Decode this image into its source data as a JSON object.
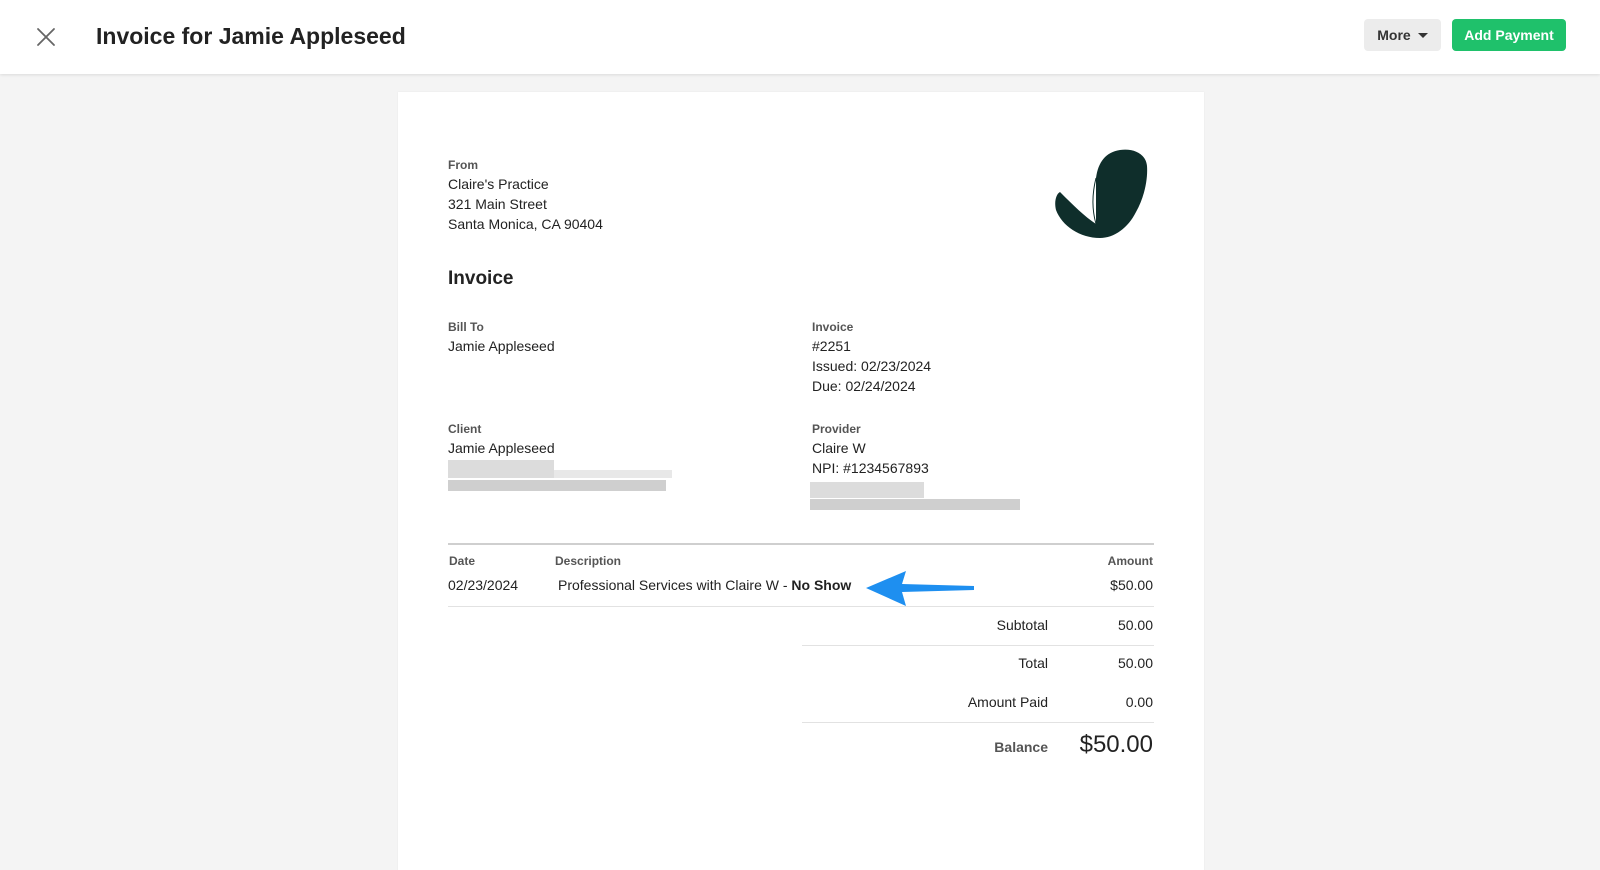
{
  "header": {
    "title": "Invoice for Jamie Appleseed",
    "more_label": "More",
    "add_payment_label": "Add Payment"
  },
  "invoice": {
    "from_label": "From",
    "from_lines": [
      "Claire's Practice",
      "321 Main Street",
      "Santa Monica, CA 90404"
    ],
    "heading": "Invoice",
    "bill_to_label": "Bill To",
    "bill_to_name": "Jamie Appleseed",
    "invoice_label": "Invoice",
    "invoice_number": "#2251",
    "issued": "Issued: 02/23/2024",
    "due": "Due: 02/24/2024",
    "client_label": "Client",
    "client_name": "Jamie Appleseed",
    "provider_label": "Provider",
    "provider_name": "Claire W",
    "provider_npi": "NPI: #1234567893",
    "table": {
      "headers": {
        "date": "Date",
        "description": "Description",
        "amount": "Amount"
      },
      "rows": [
        {
          "date": "02/23/2024",
          "description": "Professional Services with Claire W - ",
          "description_strong": "No Show",
          "amount": "$50.00"
        }
      ]
    },
    "totals": {
      "subtotal_label": "Subtotal",
      "subtotal": "50.00",
      "total_label": "Total",
      "total": "50.00",
      "amount_paid_label": "Amount Paid",
      "amount_paid": "0.00",
      "balance_label": "Balance",
      "balance": "$50.00"
    }
  },
  "colors": {
    "accent_green": "#1fc16b",
    "logo": "#0f2e2b",
    "arrow": "#1e8ff0"
  },
  "icons": {
    "close": "close-icon",
    "more_caret": "caret-down-icon",
    "logo": "leaf-logo",
    "annotation": "arrow-left-icon"
  }
}
